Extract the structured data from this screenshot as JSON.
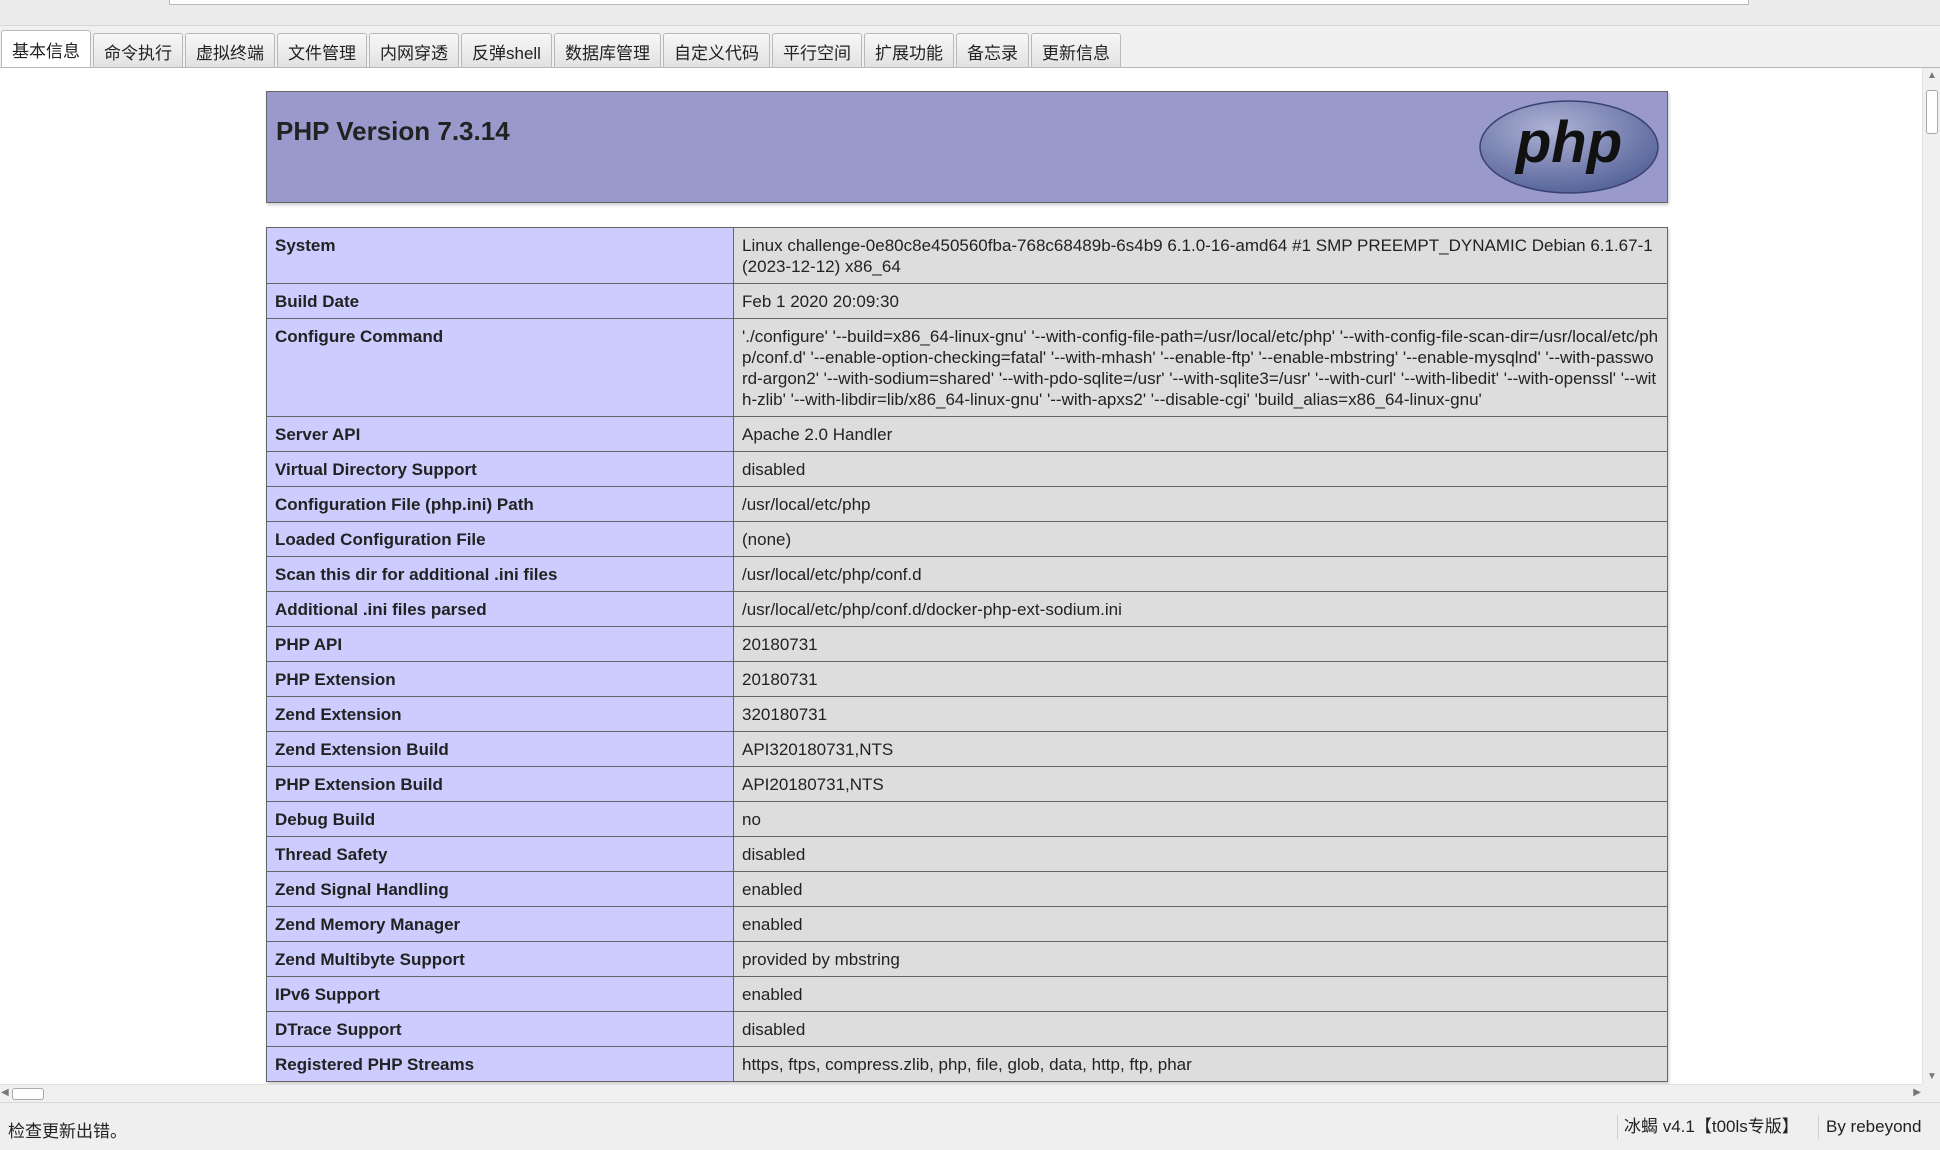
{
  "tabs": [
    "基本信息",
    "命令执行",
    "虚拟终端",
    "文件管理",
    "内网穿透",
    "反弹shell",
    "数据库管理",
    "自定义代码",
    "平行空间",
    "扩展功能",
    "备忘录",
    "更新信息"
  ],
  "active_tab": "基本信息",
  "phpinfo": {
    "title": "PHP Version 7.3.14",
    "logo_text": "php",
    "rows": [
      {
        "key": "System",
        "value": "Linux challenge-0e80c8e450560fba-768c68489b-6s4b9 6.1.0-16-amd64 #1 SMP PREEMPT_DYNAMIC Debian 6.1.67-1 (2023-12-12) x86_64"
      },
      {
        "key": "Build Date",
        "value": "Feb 1 2020 20:09:30"
      },
      {
        "key": "Configure Command",
        "value": "'./configure' '--build=x86_64-linux-gnu' '--with-config-file-path=/usr/local/etc/php' '--with-config-file-scan-dir=/usr/local/etc/php/conf.d' '--enable-option-checking=fatal' '--with-mhash' '--enable-ftp' '--enable-mbstring' '--enable-mysqlnd' '--with-password-argon2' '--with-sodium=shared' '--with-pdo-sqlite=/usr' '--with-sqlite3=/usr' '--with-curl' '--with-libedit' '--with-openssl' '--with-zlib' '--with-libdir=lib/x86_64-linux-gnu' '--with-apxs2' '--disable-cgi' 'build_alias=x86_64-linux-gnu'"
      },
      {
        "key": "Server API",
        "value": "Apache 2.0 Handler"
      },
      {
        "key": "Virtual Directory Support",
        "value": "disabled"
      },
      {
        "key": "Configuration File (php.ini) Path",
        "value": "/usr/local/etc/php"
      },
      {
        "key": "Loaded Configuration File",
        "value": "(none)"
      },
      {
        "key": "Scan this dir for additional .ini files",
        "value": "/usr/local/etc/php/conf.d"
      },
      {
        "key": "Additional .ini files parsed",
        "value": "/usr/local/etc/php/conf.d/docker-php-ext-sodium.ini"
      },
      {
        "key": "PHP API",
        "value": "20180731"
      },
      {
        "key": "PHP Extension",
        "value": "20180731"
      },
      {
        "key": "Zend Extension",
        "value": "320180731"
      },
      {
        "key": "Zend Extension Build",
        "value": "API320180731,NTS"
      },
      {
        "key": "PHP Extension Build",
        "value": "API20180731,NTS"
      },
      {
        "key": "Debug Build",
        "value": "no"
      },
      {
        "key": "Thread Safety",
        "value": "disabled"
      },
      {
        "key": "Zend Signal Handling",
        "value": "enabled"
      },
      {
        "key": "Zend Memory Manager",
        "value": "enabled"
      },
      {
        "key": "Zend Multibyte Support",
        "value": "provided by mbstring"
      },
      {
        "key": "IPv6 Support",
        "value": "enabled"
      },
      {
        "key": "DTrace Support",
        "value": "disabled"
      },
      {
        "key": "Registered PHP Streams",
        "value": "https, ftps, compress.zlib, php, file, glob, data, http, ftp, phar"
      }
    ]
  },
  "statusbar": {
    "message": "检查更新出错。",
    "version": "冰蝎 v4.1【t00ls专版】",
    "author": "By rebeyond"
  }
}
